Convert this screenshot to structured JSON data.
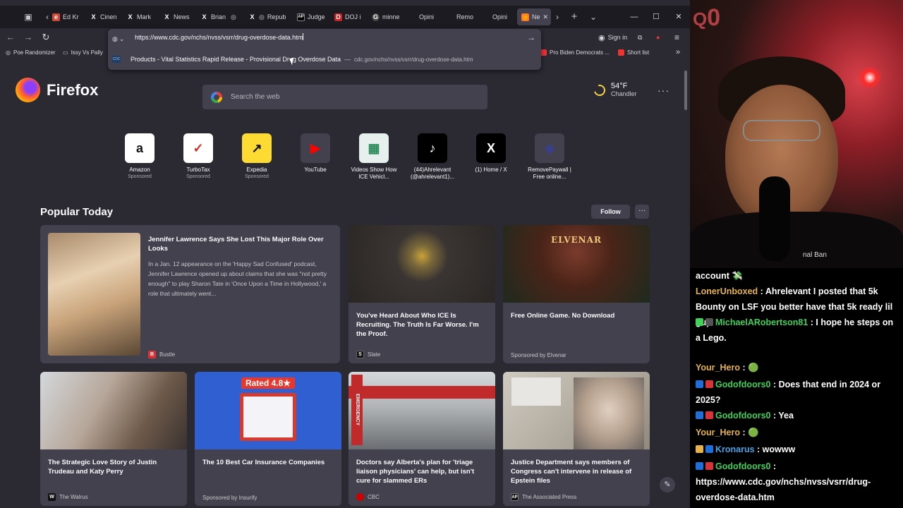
{
  "browser": {
    "tabs": [
      "Ed Kr",
      "Cinen",
      "Mark",
      "News",
      "Brian",
      "Repub",
      "Judge",
      "DOJ i",
      "minne",
      "Opini",
      "Remo",
      "Opini",
      "Ne"
    ],
    "url_value": "https://www.cdc.gov/nchs/nvss/vsrr/drug-overdose-data.htm",
    "suggestion": {
      "title": "Products - Vital Statistics Rapid Release - Provisional Drug Overdose Data",
      "sep": "—",
      "url": "cdc.gov/nchs/nvss/vsrr/drug-overdose-data.htm"
    },
    "sign_in": "Sign in",
    "bookmarks": [
      "Poe Randomizer",
      "Issy Vs Pally",
      "Pro Biden Democrats ...",
      "Short list"
    ],
    "more_bookmarks": "»"
  },
  "newtab": {
    "brand": "Firefox",
    "search_placeholder": "Search the web",
    "weather": {
      "temp": "54°F",
      "city": "Chandler"
    },
    "shortcuts": [
      {
        "name": "Amazon",
        "sub": "Sponsored",
        "glyph": "a",
        "color": "#ffffff"
      },
      {
        "name": "TurboTax",
        "sub": "Sponsored",
        "glyph": "✓",
        "color": "#d52b1e"
      },
      {
        "name": "Expedia",
        "sub": "Sponsored",
        "glyph": "↗",
        "color": "#fddb32"
      },
      {
        "name": "YouTube",
        "sub": "",
        "glyph": "▶",
        "color": "#ff0000"
      },
      {
        "name": "Videos Show How ICE Vehicl...",
        "sub": "",
        "glyph": "▦",
        "color": "#ffffff"
      },
      {
        "name": "(44)Ahrelevant (@ahrelevant1)...",
        "sub": "",
        "glyph": "♪",
        "color": "#000000"
      },
      {
        "name": "(1) Home / X",
        "sub": "",
        "glyph": "X",
        "color": "#000000"
      },
      {
        "name": "RemovePaywall | Free online...",
        "sub": "",
        "glyph": "◆",
        "color": "#3a3f8a"
      }
    ],
    "popular_title": "Popular Today",
    "follow_label": "Follow",
    "cards": [
      {
        "title": "Jennifer Lawrence Says She Lost This Major Role Over Looks",
        "excerpt": "In a Jan. 12 appearance on the 'Happy Sad Confused' podcast, Jennifer Lawrence opened up about claims that she was \"not pretty enough\" to play Sharon Tate in 'Once Upon a Time in Hollywood,' a role that ultimately went...",
        "source": "Bustle"
      },
      {
        "title": "You've Heard About Who ICE Is Recruiting. The Truth Is Far Worse. I'm the Proof.",
        "source": "Slate"
      },
      {
        "title": "Free Online Game. No Download",
        "source": "Sponsored by Elvenar",
        "img_text": "ELVENAR"
      },
      {
        "title": "The Strategic Love Story of Justin Trudeau and Katy Perry",
        "source": "The Walrus"
      },
      {
        "title": "The 10 Best Car Insurance Companies",
        "source": "Sponsored by Insurify",
        "img_text": "Rated 4.8★"
      },
      {
        "title": "Doctors say Alberta's plan for 'triage liaison physicians' can help, but isn't cure for slammed ERs",
        "source": "CBC",
        "img_text": "EMERGENCY"
      },
      {
        "title": "Justice Department says members of Congress can't intervene in release of Epstein files",
        "source": "The Associated Press"
      }
    ]
  },
  "stream": {
    "counter": "0",
    "overlay_text": "nal Ban",
    "chat": [
      {
        "user": "",
        "text": "account 💸",
        "color": "#ffffff"
      },
      {
        "user": "LonerUnboxed",
        "text": " : Ahrelevant I posted that 5k Bounty on LSF you better have that 5k ready lil gup",
        "color": "#e6b34a"
      },
      {
        "user": "MichaelARobertson81",
        "text": " : I hope he steps on a Lego.",
        "color": "#3fd158"
      },
      {
        "user": "Your_Hero",
        "text": " : 🟢",
        "color": "#e6b34a"
      },
      {
        "user": "Godofdoors0",
        "text": " : Does that end in 2024 or 2025?",
        "color": "#3fd158"
      },
      {
        "user": "Godofdoors0",
        "text": " : Yea",
        "color": "#3fd158"
      },
      {
        "user": "Your_Hero",
        "text": " : 🟢",
        "color": "#e6b34a"
      },
      {
        "user": "Kronarus",
        "text": " : wowww",
        "color": "#4aa3e6"
      },
      {
        "user": "Godofdoors0",
        "text": " : https://www.cdc.gov/nchs/nvss/vsrr/drug-overdose-data.htm",
        "color": "#3fd158"
      }
    ]
  }
}
